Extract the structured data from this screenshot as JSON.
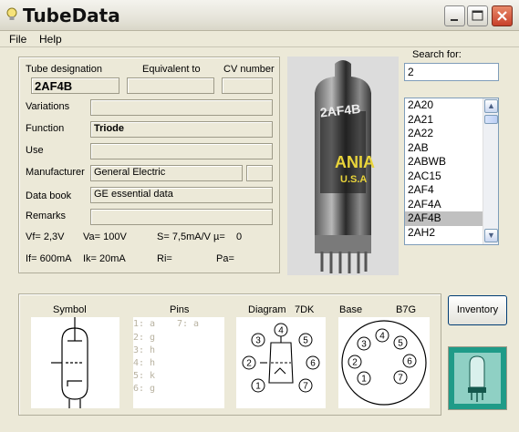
{
  "window": {
    "title": "TubeData"
  },
  "menu": {
    "file": "File",
    "help": "Help"
  },
  "labels": {
    "tube_designation": "Tube designation",
    "equivalent_to": "Equivalent to",
    "cv_number": "CV number",
    "variations": "Variations",
    "function": "Function",
    "use": "Use",
    "manufacturer": "Manufacturer",
    "data_book": "Data book",
    "remarks": "Remarks"
  },
  "values": {
    "tube_designation": "2AF4B",
    "equivalent_to": "",
    "cv_number": "",
    "variations": "",
    "function": "Triode",
    "use": "",
    "manufacturer": "General Electric",
    "manufacturer_extra": "",
    "data_book": "GE essential data",
    "remarks": ""
  },
  "params": {
    "vf": "Vf= 2,3V",
    "va": "Va= 100V",
    "s": "S= 7,5mA/V",
    "mu": "µ=",
    "mu_val": "0",
    "if": "If= 600mA",
    "ik": "Ik= 20mA",
    "ri": "Ri=",
    "pa": "Pa="
  },
  "photo": {
    "print": "2AF4B",
    "brand": "ANIA",
    "origin": "U.S.A"
  },
  "search": {
    "label": "Search for:",
    "value": "2",
    "results": [
      "2A20",
      "2A21",
      "2A22",
      "2AB",
      "2ABWB",
      "2AC15",
      "2AF4",
      "2AF4A",
      "2AF4B",
      "2AH2"
    ],
    "selected": "2AF4B"
  },
  "bottom": {
    "symbol_title": "Symbol",
    "pins_title": "Pins",
    "diagram_title": "Diagram",
    "diagram_code": "7DK",
    "base_title": "Base",
    "base_code": "B7G",
    "pins": [
      {
        "left": "1: a",
        "right": "7: a"
      },
      {
        "left": "2: g",
        "right": ""
      },
      {
        "left": "3: h",
        "right": ""
      },
      {
        "left": "4: h",
        "right": ""
      },
      {
        "left": "5: k",
        "right": ""
      },
      {
        "left": "6: g",
        "right": ""
      }
    ],
    "diagram_pins": [
      "1",
      "2",
      "3",
      "4",
      "5",
      "6",
      "7"
    ],
    "base_pins": [
      "1",
      "2",
      "3",
      "4",
      "5",
      "6",
      "7"
    ]
  },
  "buttons": {
    "inventory": "Inventory"
  }
}
